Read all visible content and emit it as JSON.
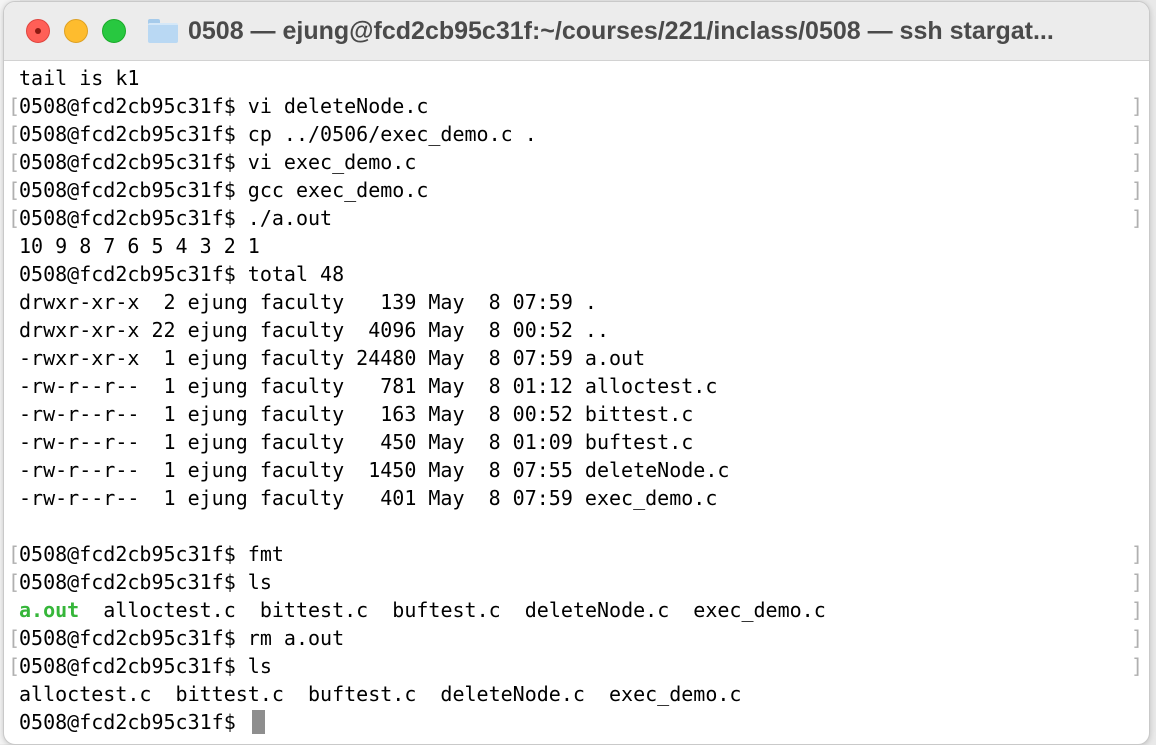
{
  "window": {
    "title": "0508 — ejung@fcd2cb95c31f:~/courses/221/inclass/0508 — ssh stargat..."
  },
  "terminal": {
    "lines": [
      {
        "text": "tail is k1",
        "marked": false
      },
      {
        "text": "0508@fcd2cb95c31f$ vi deleteNode.c",
        "marked": true
      },
      {
        "text": "0508@fcd2cb95c31f$ cp ../0506/exec_demo.c .",
        "marked": true
      },
      {
        "text": "0508@fcd2cb95c31f$ vi exec_demo.c",
        "marked": true
      },
      {
        "text": "0508@fcd2cb95c31f$ gcc exec_demo.c",
        "marked": true
      },
      {
        "text": "0508@fcd2cb95c31f$ ./a.out",
        "marked": true
      },
      {
        "text": "10 9 8 7 6 5 4 3 2 1",
        "marked": false
      },
      {
        "text": "0508@fcd2cb95c31f$ total 48",
        "marked": false
      },
      {
        "text": "drwxr-xr-x  2 ejung faculty   139 May  8 07:59 .",
        "marked": false
      },
      {
        "text": "drwxr-xr-x 22 ejung faculty  4096 May  8 00:52 ..",
        "marked": false
      },
      {
        "text": "-rwxr-xr-x  1 ejung faculty 24480 May  8 07:59 a.out",
        "marked": false
      },
      {
        "text": "-rw-r--r--  1 ejung faculty   781 May  8 01:12 alloctest.c",
        "marked": false
      },
      {
        "text": "-rw-r--r--  1 ejung faculty   163 May  8 00:52 bittest.c",
        "marked": false
      },
      {
        "text": "-rw-r--r--  1 ejung faculty   450 May  8 01:09 buftest.c",
        "marked": false
      },
      {
        "text": "-rw-r--r--  1 ejung faculty  1450 May  8 07:55 deleteNode.c",
        "marked": false
      },
      {
        "text": "-rw-r--r--  1 ejung faculty   401 May  8 07:59 exec_demo.c",
        "marked": false
      },
      {
        "text": "",
        "marked": false
      },
      {
        "text": "0508@fcd2cb95c31f$ fmt",
        "marked": true
      },
      {
        "text": "0508@fcd2cb95c31f$ ls",
        "marked": true
      }
    ],
    "ls1": {
      "exe": "a.out",
      "rest": "  alloctest.c  bittest.c  buftest.c  deleteNode.c  exec_demo.c"
    },
    "lines2": [
      {
        "text": "0508@fcd2cb95c31f$ rm a.out",
        "marked": true
      },
      {
        "text": "0508@fcd2cb95c31f$ ls",
        "marked": true
      },
      {
        "text": "alloctest.c  bittest.c  buftest.c  deleteNode.c  exec_demo.c",
        "marked": false
      }
    ],
    "prompt": "0508@fcd2cb95c31f$ "
  },
  "colors": {
    "executable": "#36b63a",
    "cursor": "#8e8e8e"
  }
}
